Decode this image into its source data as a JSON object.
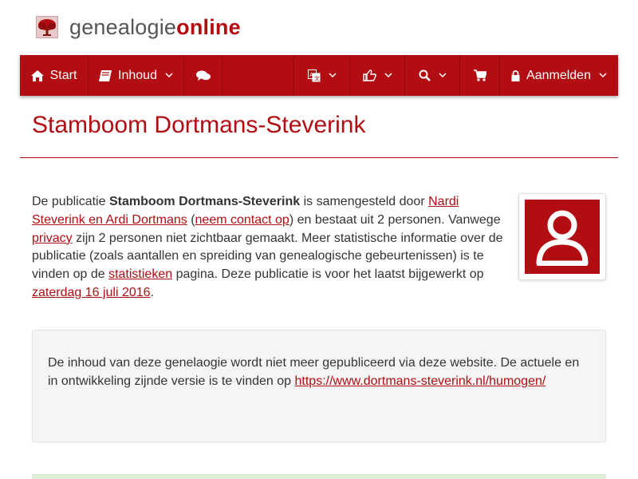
{
  "brand": {
    "part1": "genealogie",
    "part2": "online",
    "tree_color": "#b10d12"
  },
  "nav": {
    "start": {
      "label": "Start",
      "icon": "home-icon"
    },
    "inhoud": {
      "label": "Inhoud",
      "icon": "book-icon"
    },
    "chat": {
      "icon": "comments-icon"
    },
    "language": {
      "icon": "translate-icon"
    },
    "share": {
      "icon": "thumbs-up-icon"
    },
    "search": {
      "icon": "search-icon"
    },
    "cart": {
      "icon": "cart-icon"
    },
    "login": {
      "label": "Aanmelden",
      "icon": "lock-icon"
    }
  },
  "page": {
    "title": "Stamboom Dortmans-Steverink"
  },
  "intro": {
    "t1": "De publicatie ",
    "pub_name": "Stamboom Dortmans-Steverink",
    "t2": " is samengesteld door ",
    "authors_link": "Nardi Steverink en Ardi Dortmans",
    "t3": " (",
    "contact_link": "neem contact op",
    "t4": ") en bestaat uit 2 personen. Vanwege ",
    "privacy_link": "privacy",
    "t5": " zijn 2 personen niet zichtbaar gemaakt. Meer statistische informatie over de publicatie (zoals aantallen en spreiding van genealogische gebeurtenissen) is te vinden op de ",
    "stats_link": "statistieken",
    "t6": " pagina. Deze publicatie is voor het laatst bijgewerkt op ",
    "date_link": "zaterdag 16 juli 2016",
    "t7": "."
  },
  "notice": {
    "text": "De inhoud van deze genelaogie wordt niet meer gepubliceerd via deze website. De actuele en in ontwikkeling zijnde versie is te vinden op ",
    "link": "https://www.dortmans-steverink.nl/humogen/"
  },
  "colors": {
    "accent": "#b10d12",
    "notice_bg": "#f5f5f5",
    "success_bg": "#dff0d8"
  }
}
